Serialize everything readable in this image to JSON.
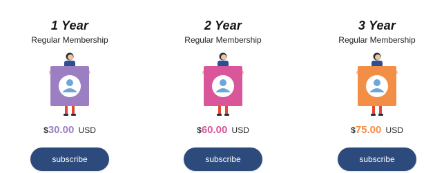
{
  "plans": [
    {
      "title": "1 Year",
      "subtitle": "Regular Membership",
      "currency_symbol": "$",
      "amount": "30.00",
      "currency_code": "USD",
      "accent_color": "#9b7fc2",
      "button_label": "subscribe"
    },
    {
      "title": "2 Year",
      "subtitle": "Regular Membership",
      "currency_symbol": "$",
      "amount": "60.00",
      "currency_code": "USD",
      "accent_color": "#d9569a",
      "button_label": "subscribe"
    },
    {
      "title": "3 Year",
      "subtitle": "Regular Membership",
      "currency_symbol": "$",
      "amount": "75.00",
      "currency_code": "USD",
      "accent_color": "#f28e45",
      "button_label": "subscribe"
    }
  ],
  "colors": {
    "button": "#2c4a7b",
    "person_hair": "#2b2f3a",
    "person_shirt": "#2d4f8f",
    "person_legs": "#e04a2f",
    "avatar_icon": "#6ea6db"
  },
  "icons": {
    "figure": "person-holding-avatar-card-icon"
  }
}
